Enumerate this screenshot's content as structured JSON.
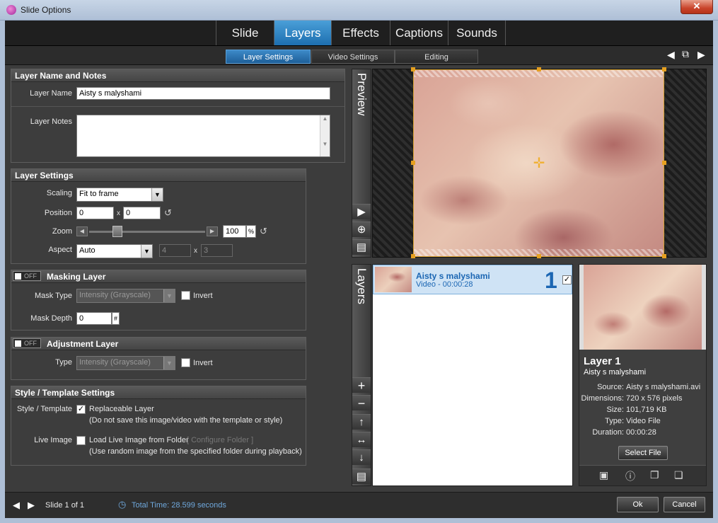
{
  "window": {
    "title": "Slide Options",
    "close_glyph": "✕"
  },
  "main_tabs": [
    {
      "label": "Slide"
    },
    {
      "label": "Layers"
    },
    {
      "label": "Effects"
    },
    {
      "label": "Captions"
    },
    {
      "label": "Sounds"
    }
  ],
  "sub_tabs": [
    {
      "label": "Layer Settings"
    },
    {
      "label": "Video Settings"
    },
    {
      "label": "Editing"
    }
  ],
  "nav": {
    "prev": "◀",
    "copy": "⧉",
    "next": "▶"
  },
  "name_notes": {
    "heading": "Layer Name and Notes",
    "name_label": "Layer Name",
    "name_value": "Aisty s malyshami",
    "notes_label": "Layer Notes",
    "notes_value": ""
  },
  "layer_settings": {
    "heading": "Layer Settings",
    "scaling_label": "Scaling",
    "scaling_value": "Fit to frame",
    "position_label": "Position",
    "position_x": "0",
    "position_y": "0",
    "zoom_label": "Zoom",
    "zoom_value": "100",
    "zoom_unit": "%",
    "zoom_level": 0.22,
    "aspect_label": "Aspect",
    "aspect_value": "Auto",
    "aspect_w": "4",
    "aspect_h": "3",
    "x_sep": "x"
  },
  "masking": {
    "toggle": "OFF",
    "heading": "Masking Layer",
    "type_label": "Mask Type",
    "type_value": "Intensity (Grayscale)",
    "invert_label": "Invert",
    "depth_label": "Mask Depth",
    "depth_value": "0",
    "depth_unit": "#"
  },
  "adjustment": {
    "toggle": "OFF",
    "heading": "Adjustment Layer",
    "type_label": "Type",
    "type_value": "Intensity (Grayscale)",
    "invert_label": "Invert"
  },
  "style_template": {
    "heading": "Style / Template Settings",
    "style_label": "Style / Template",
    "replaceable_label": "Replaceable Layer",
    "replaceable_note": "(Do not save this image/video with the template or style)",
    "live_label": "Live Image",
    "live_check_label": "Load Live Image from Folder",
    "configure_label": "[ Configure Folder ]",
    "live_note": "(Use random image from the specified folder during playback)"
  },
  "preview": {
    "label": "Preview"
  },
  "layers": {
    "label": "Layers",
    "items": [
      {
        "name": "Aisty s malyshami",
        "sub": "Video - 00:00:28",
        "number": "1"
      }
    ]
  },
  "layer_info": {
    "title": "Layer 1",
    "subtitle": "Aisty s malyshami",
    "rows": [
      {
        "key": "Source:",
        "value": "Aisty s malyshami.avi"
      },
      {
        "key": "Dimensions:",
        "value": "720 x 576 pixels"
      },
      {
        "key": "Size:",
        "value": "101,719 KB"
      },
      {
        "key": "Type:",
        "value": "Video File"
      },
      {
        "key": "Duration:",
        "value": "00:00:28"
      }
    ],
    "select_file": "Select File"
  },
  "footer": {
    "slide_counter": "Slide 1 of 1",
    "total_time": "Total Time: 28.599 seconds",
    "ok": "Ok",
    "cancel": "Cancel"
  },
  "colors": {
    "accent": "#1d6fb0",
    "link": "#1b66b3",
    "time": "#6fa8dc"
  }
}
